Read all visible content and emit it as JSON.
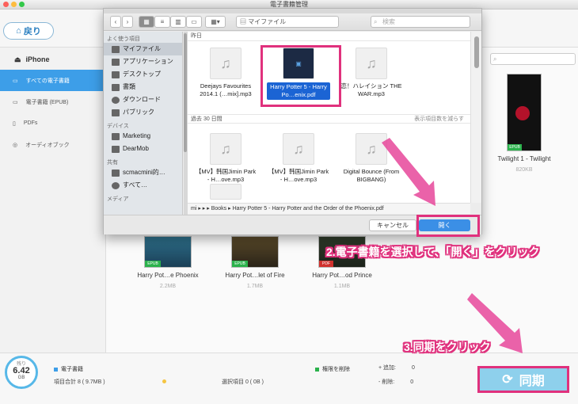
{
  "window": {
    "title": "電子書籍管理"
  },
  "app": {
    "back_label": "戻り",
    "search_placeholder": ""
  },
  "sidebar": {
    "device": "iPhone",
    "items": [
      {
        "label": "すべての電子書籍",
        "icon": "book-icon"
      },
      {
        "label": "電子書籍 (EPUB)",
        "icon": "book-open-icon"
      },
      {
        "label": "PDFs",
        "icon": "pdf-icon"
      },
      {
        "label": "オーディオブック",
        "icon": "audiobook-icon"
      }
    ]
  },
  "library": {
    "books": [
      {
        "title": "Twilight 1 - Twilight",
        "size": "820KB",
        "badge": "EPUB"
      },
      {
        "title": "Harry Pot…e Phoenix",
        "size": "2.2MB",
        "badge": "EPUB"
      },
      {
        "title": "Harry Pot…let of Fire",
        "size": "1.7MB",
        "badge": "EPUB"
      },
      {
        "title": "Harry Pot…od Prince",
        "size": "1.1MB",
        "badge": "PDF"
      }
    ]
  },
  "footer": {
    "storage_label": "残り",
    "storage_value": "6.42",
    "storage_unit": "GB",
    "legend_ebooks": "電子書籍",
    "legend_delete_rights": "権限を削除",
    "total_label": "項目合計 8 ( 9.7MB )",
    "selected_label": "選択項目 0 ( 0B )",
    "add_label": "追加:",
    "add_value": "0",
    "del_label": "削除:",
    "del_value": "0",
    "sync_label": "同期"
  },
  "dialog": {
    "location": "マイファイル",
    "search_placeholder": "検索",
    "favorites_header": "よく使う項目",
    "favorites": [
      "マイファイル",
      "アプリケーション",
      "デスクトップ",
      "書類",
      "ダウンロード",
      "パブリック"
    ],
    "devices_header": "デバイス",
    "devices": [
      "Marketing",
      "DearMob"
    ],
    "shared_header": "共有",
    "shared": [
      "scmacmini的…",
      "すべて…"
    ],
    "media_header": "メディア",
    "section_yesterday": "昨日",
    "section_30days": "過去 30 日間",
    "show_less": "表示項目数を減らす",
    "files_yesterday": [
      {
        "name": "Deejays Favourites 2014.1 (…mix].mp3"
      },
      {
        "name": "Harry Potter 5 - Harry Po…enix.pdf",
        "selected": true
      },
      {
        "name": "恋！ハレイション THE WAR.mp3"
      }
    ],
    "files_30days": [
      {
        "name": "【MV】韩国Jimin Park - H…ove.mp3"
      },
      {
        "name": "【MV】韩国Jimin Park - H…ove.mp3"
      },
      {
        "name": "Digital Bounce (From BIGBANG)"
      }
    ],
    "path": "mi ▸ ▸ ▸ Books ▸ Harry Potter 5 - Harry Potter and the Order of the Phoenix.pdf",
    "cancel_label": "キャンセル",
    "open_label": "開く"
  },
  "annotations": {
    "step2": "2.電子書籍を選択して、「開く」をクリック",
    "step3": "3.同期をクリック"
  },
  "colors": {
    "accent": "#3d9ee8",
    "highlight": "#e0317d",
    "sync": "#8ed0ec"
  }
}
